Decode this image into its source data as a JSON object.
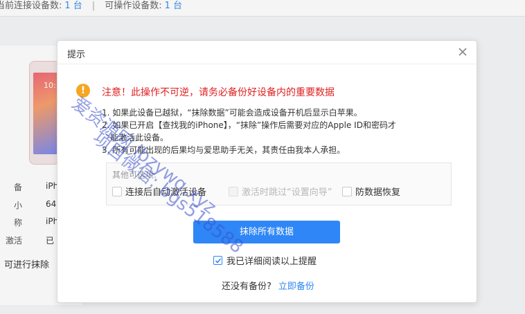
{
  "topbar": {
    "connected_label": "当前连接设备数:",
    "connected_count": "1 台",
    "separator": "|",
    "operable_label": "可操作设备数:",
    "operable_count": "1 台"
  },
  "device": {
    "time": "10:",
    "rows": [
      {
        "label": "备",
        "value": "iPh"
      },
      {
        "label": "小",
        "value": "64"
      },
      {
        "label": "称",
        "value": "iPh"
      },
      {
        "label": "激活",
        "value": "已"
      }
    ],
    "erase_note": "可进行抹除"
  },
  "dialog": {
    "title": "提示",
    "close_icon": "close-icon",
    "warning_icon": "exclamation-icon",
    "warning_title": "注意！此操作不可逆，请务必备份好设备内的重要数据",
    "notes": [
      "1. 如果此设备已越狱，“抹除数据”可能会造成设备开机后显示白苹果。",
      "2. 如果已开启【查找我的iPhone】，“抹除”操作后需要对应的Apple ID和密码才",
      "能激活此设备。",
      "3. 所有可能出现的后果均与爱思助手无关，其责任由我本人承担。"
    ],
    "options_title": "其他可选项:",
    "options": [
      {
        "label": "连接后自动激活设备",
        "checked": false,
        "disabled": false
      },
      {
        "label": "激活时跳过“设置向导”",
        "checked": false,
        "disabled": true
      },
      {
        "label": "防数据恢复",
        "checked": false,
        "disabled": false
      }
    ],
    "erase_button": "抹除所有数据",
    "confirm_label": "我已详细阅读以上提醒",
    "confirm_checked": true,
    "no_backup_question": "还没有备份?",
    "backup_link": "立即备份"
  },
  "watermark": {
    "line1": "爱资源网 lbzywq.xyz",
    "line2": "项目微信: bgs518588"
  },
  "colors": {
    "accent": "#2f86f6",
    "warning": "#e02020",
    "warning_icon": "#f5a623"
  }
}
